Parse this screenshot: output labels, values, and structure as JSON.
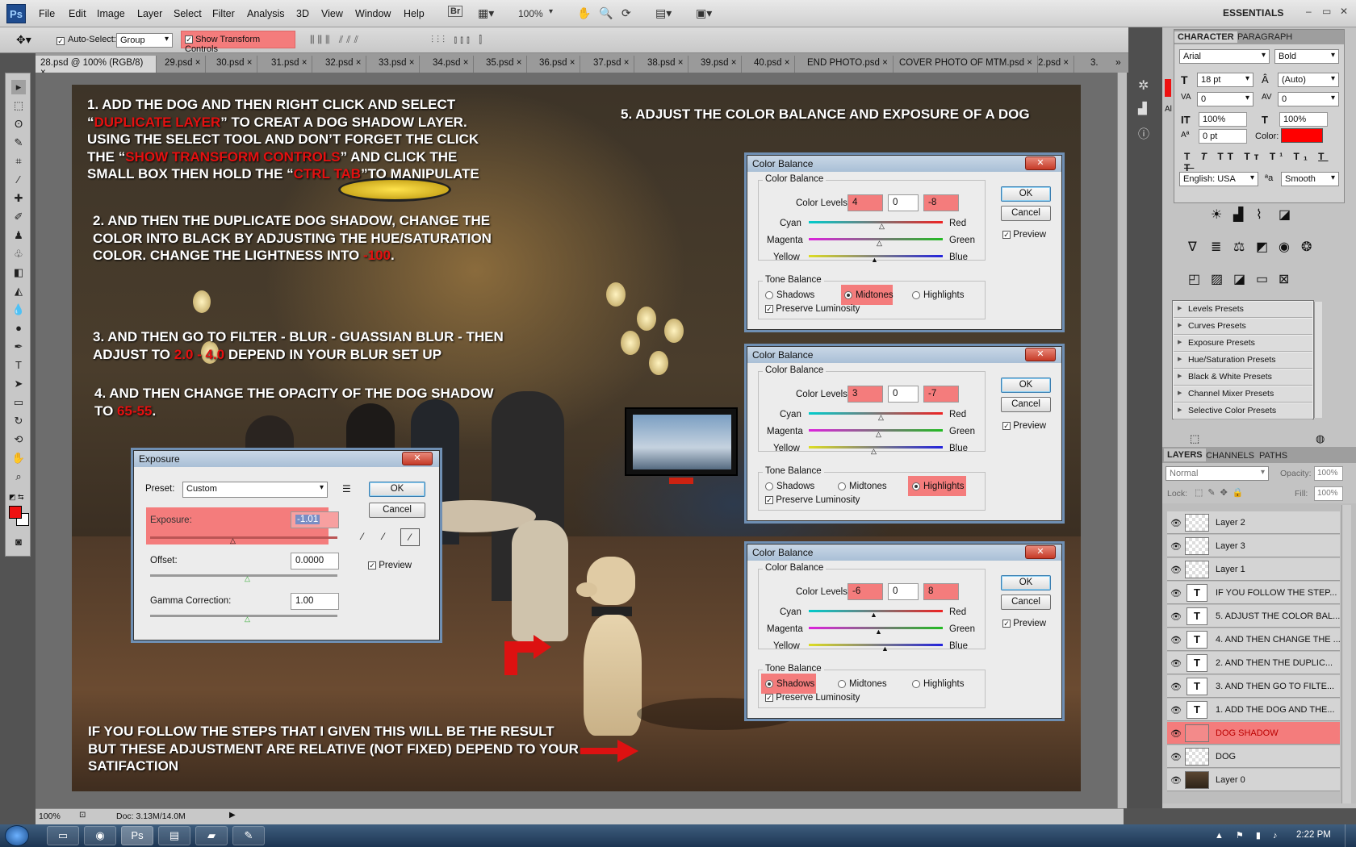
{
  "menubar": {
    "logo": "Ps",
    "items": [
      "File",
      "Edit",
      "Image",
      "Layer",
      "Select",
      "Filter",
      "Analysis",
      "3D",
      "View",
      "Window",
      "Help"
    ],
    "bridge": "Br",
    "zoom": "100%",
    "workspace": "ESSENTIALS",
    "win_min": "–",
    "win_max": "▭",
    "win_close": "✕"
  },
  "options": {
    "autoselect_label": "Auto-Select:",
    "autoselect_mode": "Group",
    "transform_label": "Show Transform Controls"
  },
  "tabs": [
    "28.psd @ 100% (RGB/8)",
    "29.psd",
    "30.psd",
    "31.psd",
    "32.psd",
    "33.psd",
    "34.psd",
    "35.psd",
    "36.psd",
    "37.psd",
    "38.psd",
    "39.psd",
    "40.psd",
    "END PHOTO.psd",
    "COVER PHOTO OF MTM.psd",
    "2.psd",
    "3."
  ],
  "tab_close": "×",
  "overlay": {
    "s1_a": "1. ADD THE DOG AND THEN RIGHT CLICK AND SELECT",
    "s1_b_pre": "“",
    "s1_b_red": "DUPLICATE LAYER",
    "s1_b_post": "” TO CREAT A DOG SHADOW LAYER.",
    "s1_c": "USING THE SELECT TOOL AND DON’T FORGET THE CLICK",
    "s1_d_pre": "THE “",
    "s1_d_red": "SHOW TRANSFORM CONTROLS",
    "s1_d_post": "” AND CLICK THE",
    "s1_e_pre": "SMALL BOX THEN HOLD THE “",
    "s1_e_red": "CTRL TAB",
    "s1_e_post": "”TO MANIPULATE",
    "s2_a": "2. AND THEN  THE DUPLICATE DOG SHADOW, CHANGE THE",
    "s2_b": "COLOR INTO BLACK BY ADJUSTING THE HUE/SATURATION",
    "s2_c_pre": "COLOR. CHANGE THE LIGHTNESS INTO ",
    "s2_c_red": "-100",
    "s2_c_post": ".",
    "s3_a": "3. AND THEN GO TO FILTER - BLUR - GUASSIAN BLUR - THEN",
    "s3_b_pre": "ADJUST TO ",
    "s3_b_red": "2.0 - 4.0",
    "s3_b_post": " DEPEND IN YOUR BLUR SET UP",
    "s4_a": "4. AND THEN CHANGE THE OPACITY OF THE DOG SHADOW",
    "s4_b_pre": "TO ",
    "s4_b_red": "65-55",
    "s4_b_post": ".",
    "s5": "5. ADJUST THE COLOR BALANCE AND EXPOSURE OF A DOG",
    "result_a": "IF YOU FOLLOW THE STEPS THAT I GIVEN THIS WILL BE THE RESULT",
    "result_b": "BUT THESE ADJUSTMENT ARE RELATIVE (NOT FIXED) DEPEND TO YOUR",
    "result_c": "SATIFACTION"
  },
  "exposure": {
    "title": "Exposure",
    "preset_label": "Preset:",
    "preset_value": "Custom",
    "exposure_label": "Exposure:",
    "exposure_value": "-1.01",
    "offset_label": "Offset:",
    "offset_value": "0.0000",
    "gamma_label": "Gamma Correction:",
    "gamma_value": "1.00",
    "ok": "OK",
    "cancel": "Cancel",
    "preview": "Preview"
  },
  "cb_common": {
    "title": "Color Balance",
    "group": "Color Balance",
    "levels_label": "Color Levels:",
    "cyan": "Cyan",
    "red": "Red",
    "magenta": "Magenta",
    "green": "Green",
    "yellow": "Yellow",
    "blue": "Blue",
    "tone": "Tone Balance",
    "shadows": "Shadows",
    "midtones": "Midtones",
    "highlights": "Highlights",
    "preserve": "Preserve Luminosity",
    "ok": "OK",
    "cancel": "Cancel",
    "preview": "Preview"
  },
  "cb1": {
    "l1": "4",
    "l2": "0",
    "l3": "-8",
    "tone": "midtones"
  },
  "cb2": {
    "l1": "3",
    "l2": "0",
    "l3": "-7",
    "tone": "highlights"
  },
  "cb3": {
    "l1": "-6",
    "l2": "0",
    "l3": "8",
    "tone": "shadows"
  },
  "character": {
    "tab1": "CHARACTER",
    "tab2": "PARAGRAPH",
    "font": "Arial",
    "style": "Bold",
    "size": "18 pt",
    "leading": "(Auto)",
    "kern": "0",
    "track": "0",
    "vscale": "100%",
    "hscale": "100%",
    "baseline": "0 pt",
    "color_label": "Color:",
    "language": "English: USA",
    "aa_label": "aa",
    "aa": "Smooth",
    "color": "#ff0000"
  },
  "presets": [
    "Levels Presets",
    "Curves Presets",
    "Exposure Presets",
    "Hue/Saturation Presets",
    "Black & White Presets",
    "Channel Mixer Presets",
    "Selective Color Presets"
  ],
  "layers_panel": {
    "tab1": "LAYERS",
    "tab2": "CHANNELS",
    "tab3": "PATHS",
    "blend": "Normal",
    "opacity_label": "Opacity:",
    "opacity": "100%",
    "lock_label": "Lock:",
    "fill_label": "Fill:",
    "fill": "100%"
  },
  "layers": [
    {
      "name": "Layer 2",
      "type": "raster"
    },
    {
      "name": "Layer 3",
      "type": "raster"
    },
    {
      "name": "Layer 1",
      "type": "raster"
    },
    {
      "name": "IF YOU FOLLOW THE STEP...",
      "type": "text"
    },
    {
      "name": "5. ADJUST THE COLOR BAL...",
      "type": "text"
    },
    {
      "name": "4. AND THEN CHANGE THE ...",
      "type": "text"
    },
    {
      "name": "2. AND THEN  THE DUPLIC...",
      "type": "text"
    },
    {
      "name": "3. AND THEN GO TO FILTE...",
      "type": "text"
    },
    {
      "name": "1. ADD THE DOG AND THE...",
      "type": "text"
    },
    {
      "name": "DOG SHADOW",
      "type": "raster",
      "selected": true
    },
    {
      "name": "DOG",
      "type": "raster"
    },
    {
      "name": "Layer 0",
      "type": "photo"
    }
  ],
  "status": {
    "zoom": "100%",
    "doc": "Doc: 3.13M/14.0M"
  },
  "taskbar": {
    "clock": "2:22 PM"
  }
}
